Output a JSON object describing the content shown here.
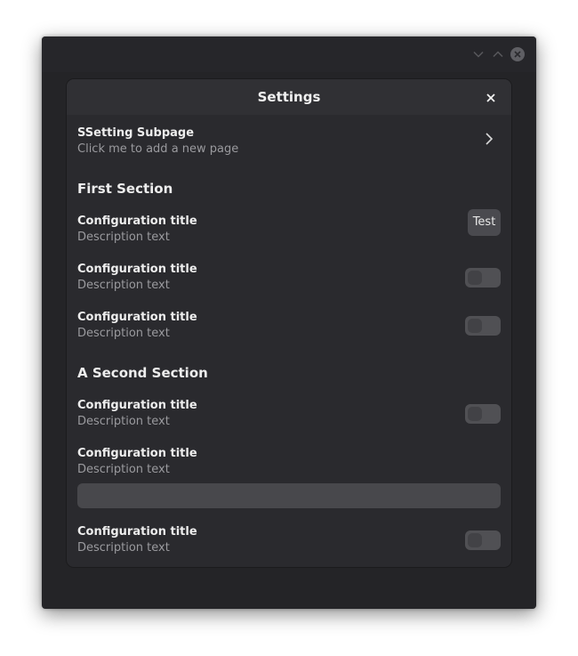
{
  "dialog": {
    "title": "Settings"
  },
  "subpage": {
    "title": "SSetting Subpage",
    "description": "Click me to add a new page"
  },
  "sections": [
    {
      "title": "First Section",
      "rows": [
        {
          "title": "Configuration title",
          "description": "Description text",
          "control": "button",
          "button_label": "Test"
        },
        {
          "title": "Configuration title",
          "description": "Description text",
          "control": "switch",
          "on": false
        },
        {
          "title": "Configuration title",
          "description": "Description text",
          "control": "switch",
          "on": false
        }
      ]
    },
    {
      "title": "A Second Section",
      "rows": [
        {
          "title": "Configuration title",
          "description": "Description text",
          "control": "switch",
          "on": false
        },
        {
          "title": "Configuration title",
          "description": "Description text",
          "control": "text-entry",
          "value": ""
        },
        {
          "title": "Configuration title",
          "description": "Description text",
          "control": "switch",
          "on": false
        }
      ]
    }
  ],
  "icons": {
    "window_minimize": "chevron-down-icon",
    "window_maximize": "chevron-up-icon",
    "window_close": "close-icon",
    "dialog_close": "close-icon",
    "subpage": "chevron-right-icon"
  },
  "colors": {
    "window_bg": "#242427",
    "dialog_bg": "#2a2a2e",
    "dialog_header_bg": "#303034",
    "switch_off": "#505054",
    "button_bg": "#4a4a4f",
    "entry_bg": "#48484c"
  }
}
